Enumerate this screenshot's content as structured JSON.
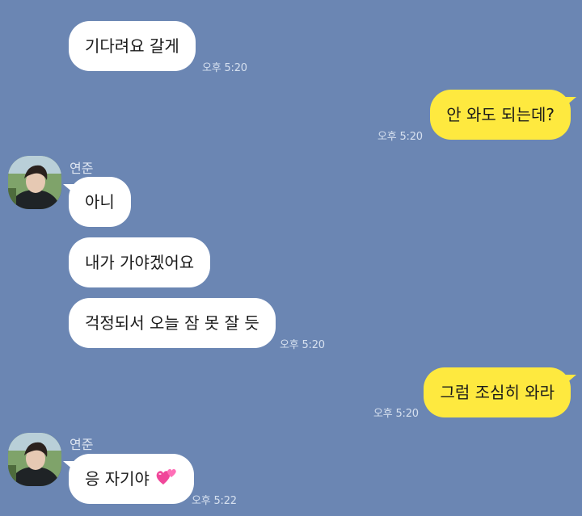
{
  "messages": [
    {
      "text": "기다려요 갈게",
      "time": "오후 5:20"
    },
    {
      "text": "안 와도 되는데?",
      "time": "오후 5:20"
    },
    {
      "sender": "연준"
    },
    {
      "text": "아니"
    },
    {
      "text": "내가 가야겠어요"
    },
    {
      "text": "걱정되서 오늘 잠 못 잘 듯",
      "time": "오후 5:20"
    },
    {
      "text": "그럼 조심히 와라",
      "time": "오후 5:20"
    },
    {
      "sender": "연준"
    },
    {
      "text": "응 자기야",
      "emoji": "two-hearts-icon",
      "time": "오후 5:22"
    }
  ],
  "colors": {
    "background": "#6b86b3",
    "incoming_bubble": "#ffffff",
    "outgoing_bubble": "#fee93f"
  }
}
